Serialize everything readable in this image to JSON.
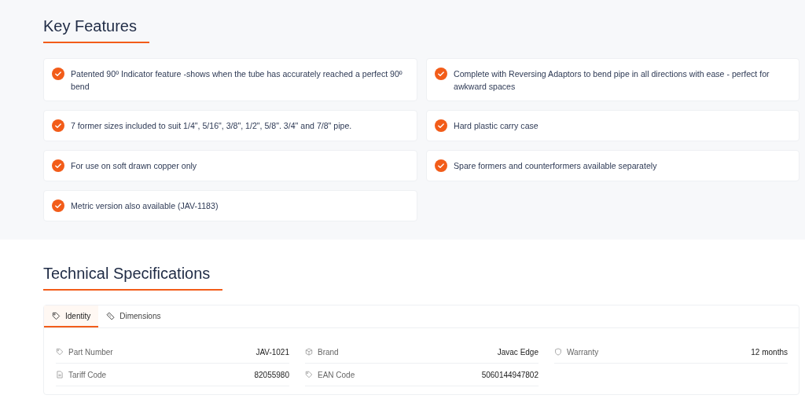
{
  "key_features": {
    "title": "Key Features",
    "items": [
      {
        "text": "Patented 90º Indicator feature -shows when the tube has accurately reached a perfect 90º bend"
      },
      {
        "text": "Complete with Reversing Adaptors to bend pipe in all directions with ease - perfect for awkward spaces"
      },
      {
        "text": "7 former sizes included to suit 1/4\", 5/16\", 3/8\", 1/2\", 5/8\". 3/4\" and 7/8\" pipe."
      },
      {
        "text": "Hard plastic carry case"
      },
      {
        "text": "For use on soft drawn copper only"
      },
      {
        "text": "Spare formers and counterformers available separately"
      },
      {
        "text": "Metric version also available (JAV-1183)"
      }
    ]
  },
  "technical_specifications": {
    "title": "Technical Specifications",
    "tabs": [
      {
        "label": "Identity",
        "kind": "tag",
        "selected": true
      },
      {
        "label": "Dimensions",
        "kind": "ruler",
        "selected": false
      }
    ],
    "specs": [
      {
        "kind": "tag",
        "label": "Part Number",
        "value": "JAV-1021"
      },
      {
        "kind": "box",
        "label": "Brand",
        "value": "Javac Edge"
      },
      {
        "kind": "shield",
        "label": "Warranty",
        "value": "12 months"
      },
      {
        "kind": "document",
        "label": "Tariff Code",
        "value": "82055980"
      },
      {
        "kind": "tag",
        "label": "EAN Code",
        "value": "5060144947802"
      }
    ]
  }
}
